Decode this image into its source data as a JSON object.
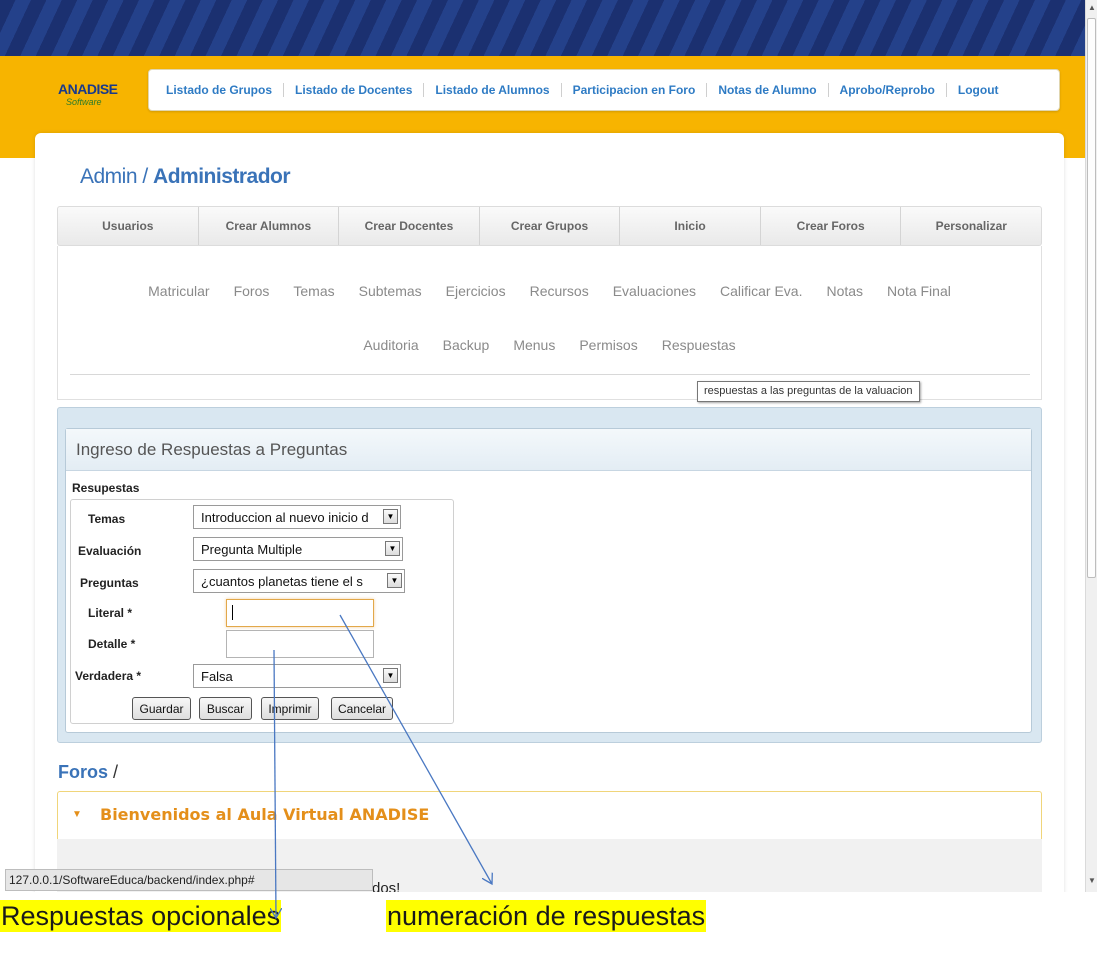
{
  "logo": {
    "main": "ANADISE",
    "sub": "Software"
  },
  "topnav": [
    "Listado de Grupos",
    "Listado de Docentes",
    "Listado de Alumnos",
    "Participacion en Foro",
    "Notas de Alumno",
    "Aprobo/Reprobo",
    "Logout"
  ],
  "breadcrumb": {
    "section": "Admin",
    "separator": " / ",
    "current": "Administrador"
  },
  "tabs": [
    "Usuarios",
    "Crear Alumnos",
    "Crear Docentes",
    "Crear Grupos",
    "Inicio",
    "Crear Foros",
    "Personalizar"
  ],
  "sublinks_row1": [
    "Matricular",
    "Foros",
    "Temas",
    "Subtemas",
    "Ejercicios",
    "Recursos",
    "Evaluaciones",
    "Calificar Eva.",
    "Notas",
    "Nota Final"
  ],
  "sublinks_row2": [
    "Auditoria",
    "Backup",
    "Menus",
    "Permisos",
    "Respuestas"
  ],
  "tooltip": "respuestas a las preguntas de la valuacion",
  "form": {
    "title": "Ingreso de Respuestas a Preguntas",
    "legend": "Resupestas",
    "temas_label": "Temas",
    "temas_value": "Introduccion al nuevo inicio d",
    "evaluacion_label": "Evaluación",
    "evaluacion_value": "Pregunta Multiple",
    "preguntas_label": "Preguntas",
    "preguntas_value": "¿cuantos planetas tiene el s",
    "literal_label": "Literal *",
    "literal_value": "",
    "detalle_label": "Detalle *",
    "detalle_value": "",
    "verdadera_label": "Verdadera *",
    "verdadera_value": "Falsa",
    "buttons": {
      "save": "Guardar",
      "search": "Buscar",
      "print": "Imprimir",
      "cancel": "Cancelar"
    }
  },
  "foros": {
    "title": "Foros",
    "separator": " /",
    "item_title": "Bienvenidos al Aula Virtual ANADISE",
    "partial_text": "dos!"
  },
  "status_url": "127.0.0.1/SoftwareEduca/backend/index.php#",
  "annotations": {
    "left": "Respuestas opcionales",
    "right": "numeración de respuestas"
  },
  "colors": {
    "header_blue": "#1b3070",
    "header_yellow": "#f7b400",
    "link_blue": "#2e7bc4",
    "accent_orange": "#e48f1a",
    "highlight": "#ffff00",
    "arrow": "#4a78c2"
  }
}
